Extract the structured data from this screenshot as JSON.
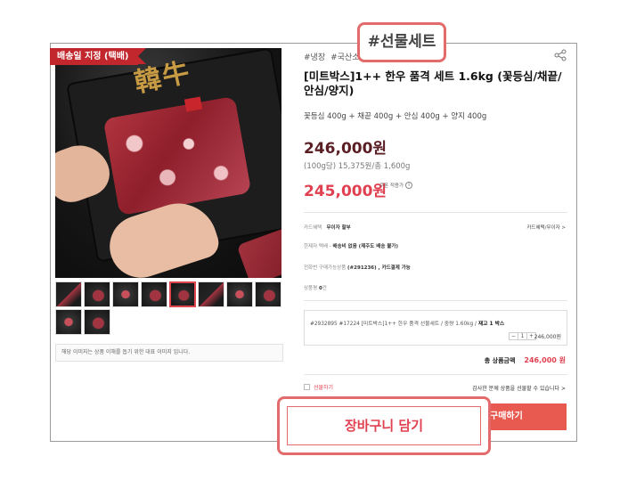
{
  "colors": {
    "accent": "#e04050",
    "ribbon": "#c1272d",
    "highlight": "#e36b6b",
    "price_dark": "#5a1e24"
  },
  "ribbon": {
    "label": "배송일 지정 (택배)"
  },
  "tags": [
    "#냉장",
    "#국산소"
  ],
  "tag_popup": "#선물세트",
  "product": {
    "title": "[미트박스]1++ 한우 품격 세트 1.6kg (꽃등심/채끝/안심/양지)",
    "composition": "꽃등심 400g + 채끝 400g + 안심 400g + 양지 400g",
    "price_original": "246,000원",
    "price_unit": "(100g당) 15,375원/총 1,600g",
    "price_sale": "245,000원",
    "coupon_label": "쿠폰 적용가"
  },
  "info_rows": {
    "card": {
      "label": "카드혜택",
      "value": "무이자 할부",
      "link": "카드혜택/무이자 >"
    },
    "delivery": {
      "label": "한제자 택배 -",
      "value": "배송비 없음 (제주도 배송 불가)"
    },
    "seller": {
      "label": "전화번 구매가능상품",
      "value": "(#291236) , 카드결제 가능"
    },
    "review": {
      "label": "상품평",
      "value": "0",
      "suffix": "건"
    }
  },
  "option": {
    "code": "#2932895 #17224 [미트박스]1++ 한우 품격 선물세트 / 중량 1.60kg /",
    "stock": "재고 1 박스",
    "minus": "−",
    "qty": "1",
    "plus": "+",
    "price": "246,000원"
  },
  "total": {
    "label": "총 상품금액",
    "amount": "246,000 원"
  },
  "gift": {
    "checkbox_label": "선물하기",
    "note": "감사한 분께 상품을 선물할 수 있습니다 >"
  },
  "buttons": {
    "buy": "구매하기",
    "cart": "장바구니 담기"
  },
  "caption": "해당 이미지는 상품 이해를 돕기 위한 대표 이미지 입니다.",
  "photo": {
    "brand_mark": "韓牛"
  },
  "icons": {
    "share": "share-icon",
    "info": "info-icon"
  }
}
